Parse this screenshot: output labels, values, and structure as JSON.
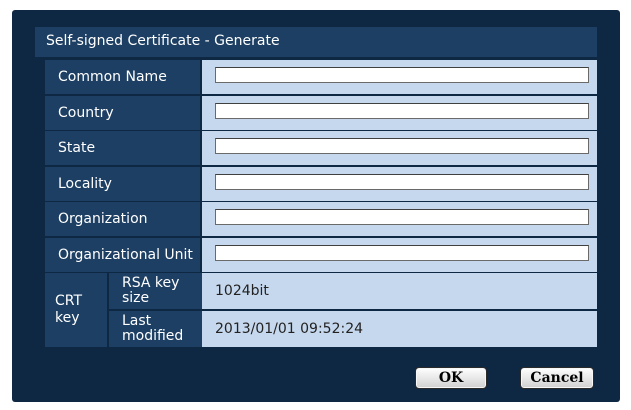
{
  "dialog": {
    "title": "Self-signed Certificate - Generate"
  },
  "fields": [
    {
      "label": "Common Name",
      "value": ""
    },
    {
      "label": "Country",
      "value": ""
    },
    {
      "label": "State",
      "value": ""
    },
    {
      "label": "Locality",
      "value": ""
    },
    {
      "label": "Organization",
      "value": ""
    },
    {
      "label": "Organizational Unit",
      "value": ""
    }
  ],
  "crt_key": {
    "label_line1": "CRT",
    "label_line2": "key",
    "rsa_key_size_label_line1": "RSA key",
    "rsa_key_size_label_line2": "size",
    "rsa_key_size_value": "1024bit",
    "last_modified_label_line1": "Last",
    "last_modified_label_line2": "modified",
    "last_modified_value": "2013/01/01 09:52:24"
  },
  "buttons": {
    "ok": "OK",
    "cancel": "Cancel"
  }
}
